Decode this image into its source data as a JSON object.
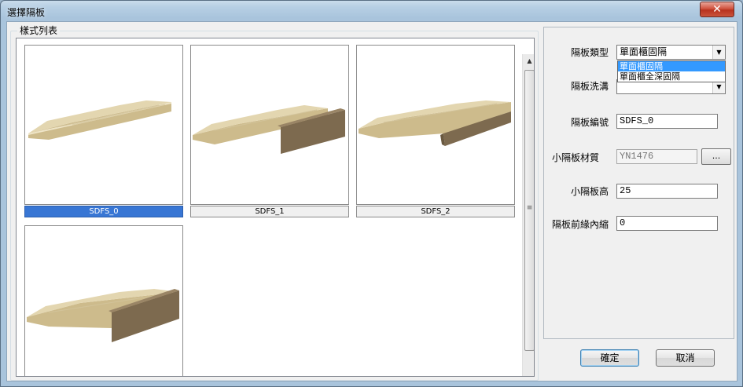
{
  "window": {
    "title": "選擇隔板",
    "close_label": "✕"
  },
  "styles_group": {
    "label": "樣式列表",
    "items": [
      {
        "name": "SDFS_0",
        "selected": true
      },
      {
        "name": "SDFS_1",
        "selected": false
      },
      {
        "name": "SDFS_2",
        "selected": false
      },
      {
        "name": "",
        "selected": false
      }
    ],
    "scroll": {
      "up": "▲",
      "down": "▼",
      "grip": "≡"
    }
  },
  "form": {
    "board_type": {
      "label": "隔板類型",
      "value": "單面櫃固隔",
      "options": [
        "單面櫃固隔",
        "單面櫃全深固隔"
      ],
      "highlighted": "單面櫃固隔"
    },
    "groove": {
      "label": "隔板洗溝",
      "value": ""
    },
    "board_code": {
      "label": "隔板編號",
      "value": "SDFS_0"
    },
    "small_material": {
      "label": "小隔板材質",
      "value": "YN1476",
      "browse_label": "..."
    },
    "small_height": {
      "label": "小隔板高",
      "value": "25"
    },
    "front_inset": {
      "label": "隔板前緣內縮",
      "value": "0"
    }
  },
  "buttons": {
    "ok": "確定",
    "cancel": "取消"
  },
  "colors": {
    "wood_top": "#e3d6b0",
    "wood_front": "#cdbb8c",
    "dark_wood": "#7d6a4f",
    "selection": "#3876d4"
  }
}
